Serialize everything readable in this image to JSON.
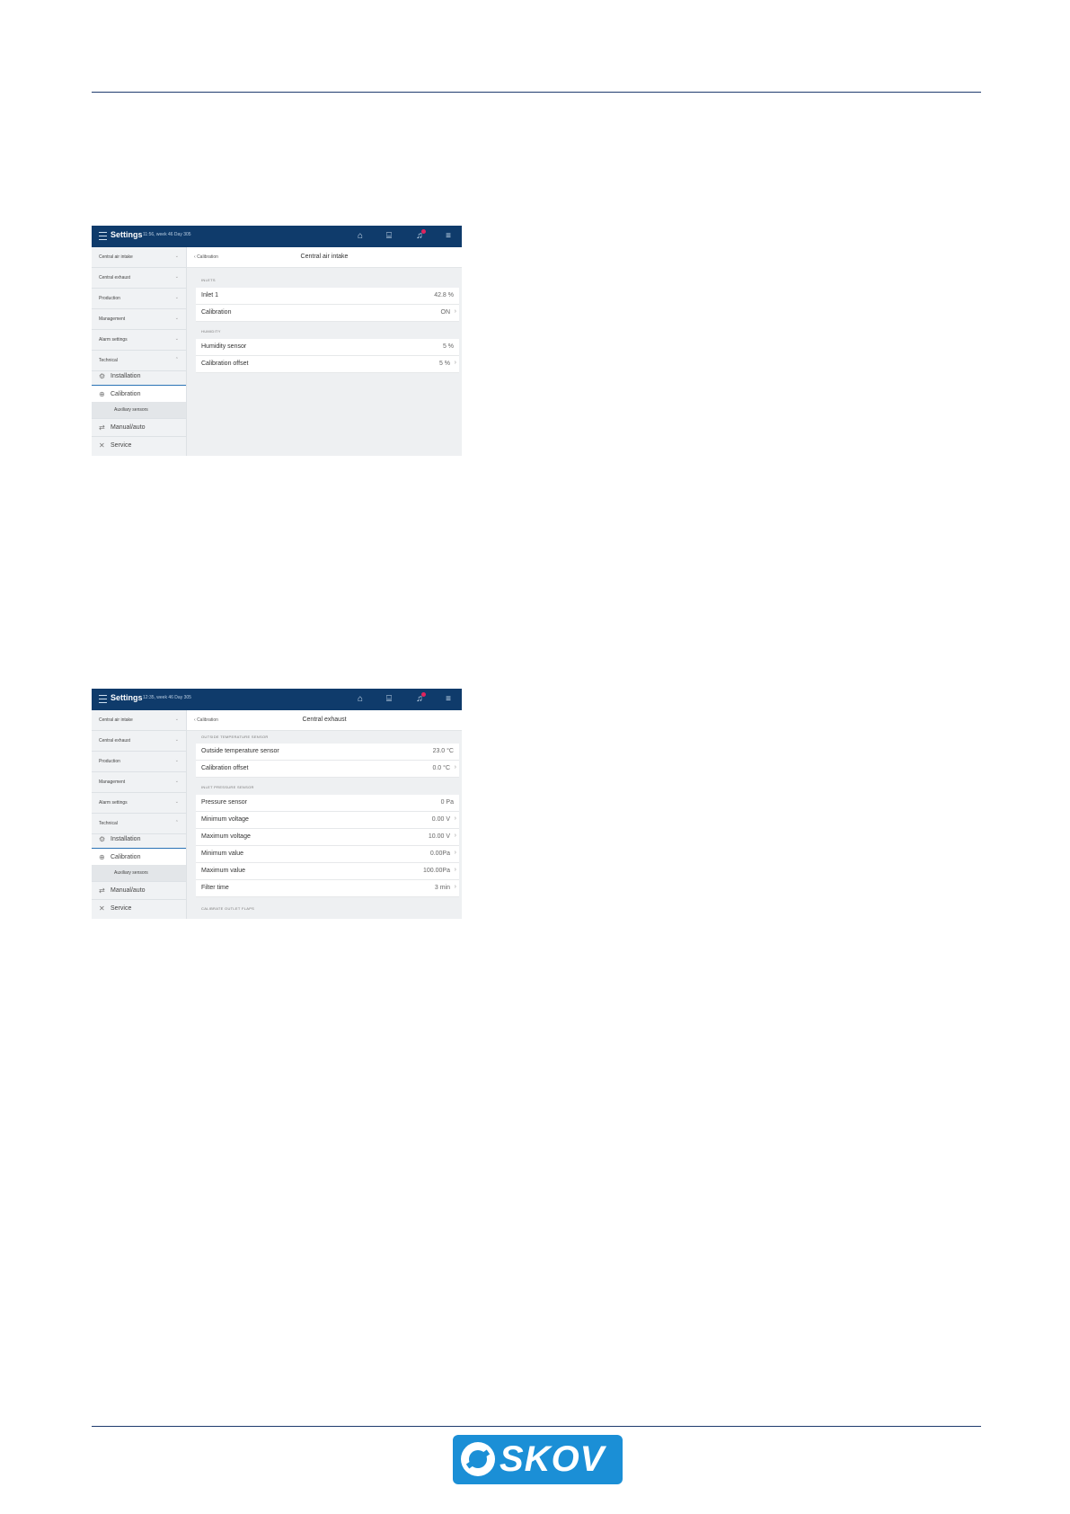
{
  "brand": {
    "logo_text": "SKOV",
    "accent": "#1b8fd6"
  },
  "screens": [
    {
      "topbar": {
        "title": "Settings",
        "subtitle": "11:56, week 46 Day 305"
      },
      "sidebar": {
        "items": [
          "Central air intake",
          "Central exhaust",
          "Production",
          "Management",
          "Alarm settings",
          "Technical"
        ],
        "installation": "Installation",
        "calibration": "Calibration",
        "auxiliary": "Auxiliary sensors",
        "manual": "Manual/auto",
        "service": "Service"
      },
      "breadcrumb": "Calibration",
      "page_title": "Central air intake",
      "section1": "INLETS",
      "rows1": [
        {
          "label": "Inlet 1",
          "value": "42.8 %"
        },
        {
          "label": "Calibration",
          "value": "ON"
        }
      ],
      "section2": "HUMIDITY",
      "rows2": [
        {
          "label": "Humidity sensor",
          "value": "5 %"
        },
        {
          "label": "Calibration offset",
          "value": "5 %"
        }
      ]
    },
    {
      "topbar": {
        "title": "Settings",
        "subtitle": "12:35, week 46 Day 305"
      },
      "sidebar": {
        "items": [
          "Central air intake",
          "Central exhaust",
          "Production",
          "Management",
          "Alarm settings",
          "Technical"
        ],
        "installation": "Installation",
        "calibration": "Calibration",
        "auxiliary": "Auxiliary sensors",
        "manual": "Manual/auto",
        "service": "Service"
      },
      "breadcrumb": "Calibration",
      "page_title": "Central exhaust",
      "section1": "OUTSIDE TEMPERATURE SENSOR",
      "rows1": [
        {
          "label": "Outside temperature sensor",
          "value": "23.0 °C"
        },
        {
          "label": "Calibration offset",
          "value": "0.0 °C"
        }
      ],
      "section2": "INLET PRESSURE SENSOR",
      "rows2": [
        {
          "label": "Pressure sensor",
          "value": "0 Pa"
        },
        {
          "label": "Minimum voltage",
          "value": "0.00 V"
        },
        {
          "label": "Maximum voltage",
          "value": "10.00 V"
        },
        {
          "label": "Minimum value",
          "value": "0.00Pa"
        },
        {
          "label": "Maximum value",
          "value": "100.00Pa"
        },
        {
          "label": "Filter time",
          "value": "3 min"
        }
      ],
      "section3": "CALIBRATE OUTLET FLAPS"
    }
  ]
}
